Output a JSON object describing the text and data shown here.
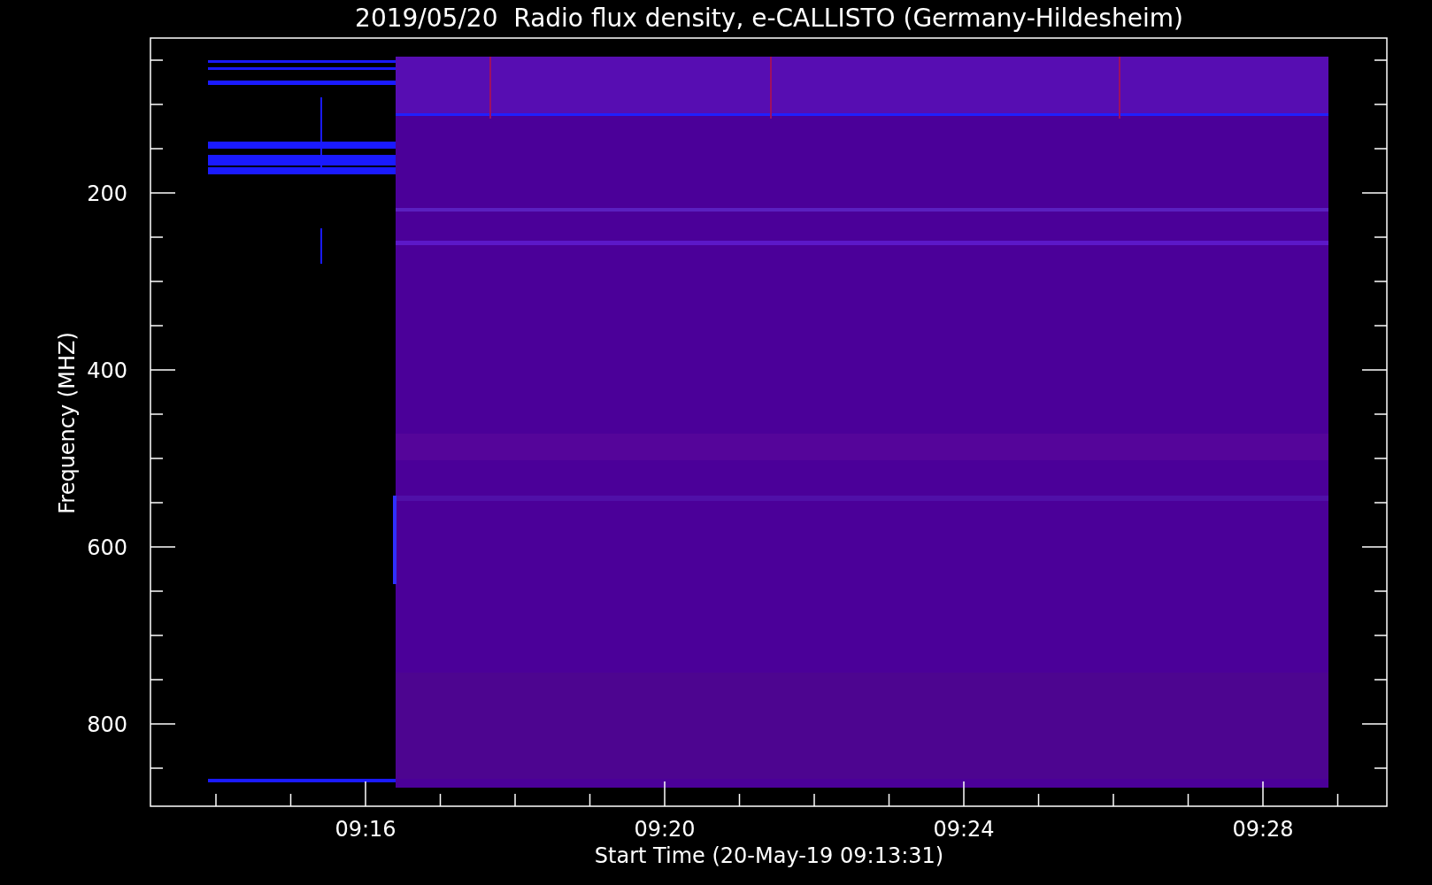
{
  "title": "2019/05/20  Radio flux density, e-CALLISTO (Germany-Hildesheim)",
  "y_axis": {
    "label": "Frequency (MHZ)",
    "tick_labels": [
      "200",
      "400",
      "600",
      "800"
    ]
  },
  "x_axis": {
    "label": "Start Time (20-May-19 09:13:31)",
    "tick_labels": [
      "09:16",
      "09:20",
      "09:24",
      "09:28"
    ]
  }
}
